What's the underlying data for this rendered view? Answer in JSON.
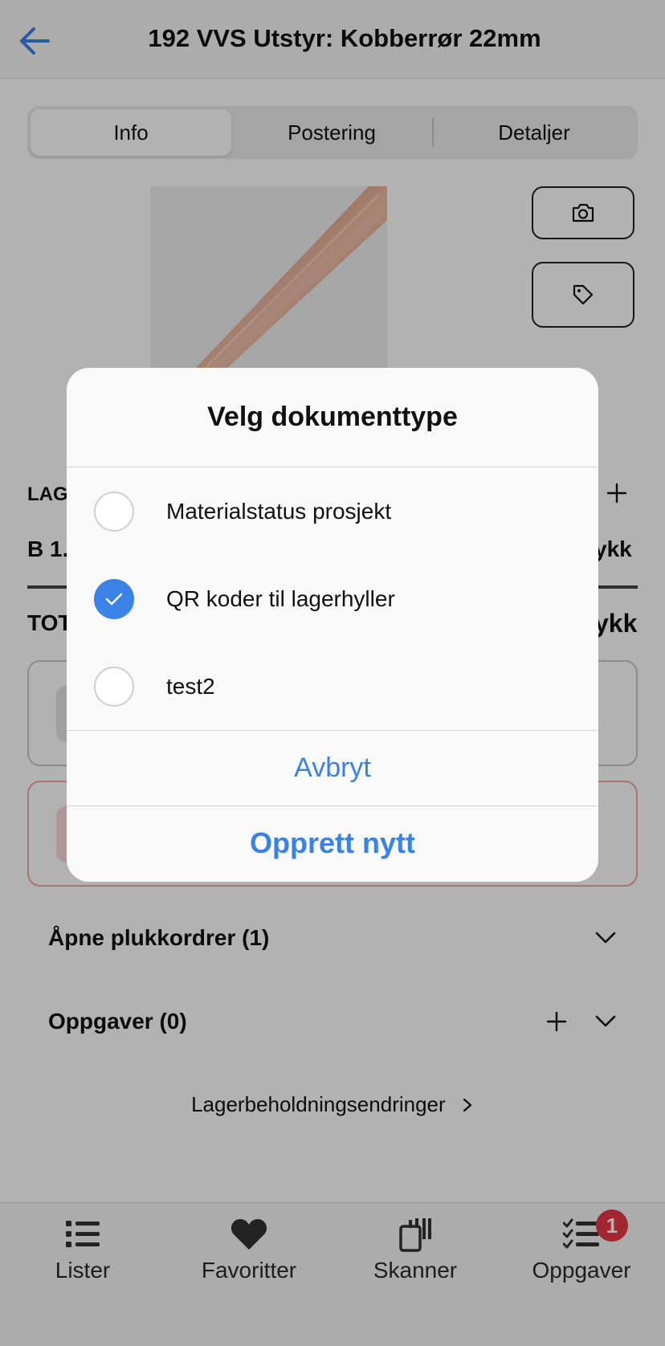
{
  "header": {
    "title": "192 VVS Utstyr: Kobberrør 22mm"
  },
  "tabs": [
    {
      "label": "Info",
      "active": true
    },
    {
      "label": "Postering",
      "active": false
    },
    {
      "label": "Detaljer",
      "active": false
    }
  ],
  "background": {
    "lager_label": "LAG",
    "location_label": "B 1.",
    "location_unit": "ykk",
    "total_label": "TOT",
    "total_unit": "ykk"
  },
  "sections": {
    "open_pick_orders": "Åpne plukkordrer (1)",
    "tasks": "Oppgaver (0)"
  },
  "inventory_changes_link": "Lagerbeholdningsendringer",
  "tabbar": {
    "items": [
      {
        "label": "Lister",
        "icon": "list-icon"
      },
      {
        "label": "Favoritter",
        "icon": "heart-icon"
      },
      {
        "label": "Skanner",
        "icon": "scanner-icon"
      },
      {
        "label": "Oppgaver",
        "icon": "checklist-icon",
        "badge": "1"
      }
    ]
  },
  "dialog": {
    "title": "Velg dokumenttype",
    "options": [
      {
        "label": "Materialstatus prosjekt",
        "checked": false
      },
      {
        "label": "QR koder til lagerhyller",
        "checked": true
      },
      {
        "label": "test2",
        "checked": false
      }
    ],
    "cancel_label": "Avbryt",
    "create_label": "Opprett nytt"
  },
  "colors": {
    "accent": "#3b82e6",
    "badge": "#e53945",
    "overlay": "rgba(0,0,0,0.30)"
  }
}
